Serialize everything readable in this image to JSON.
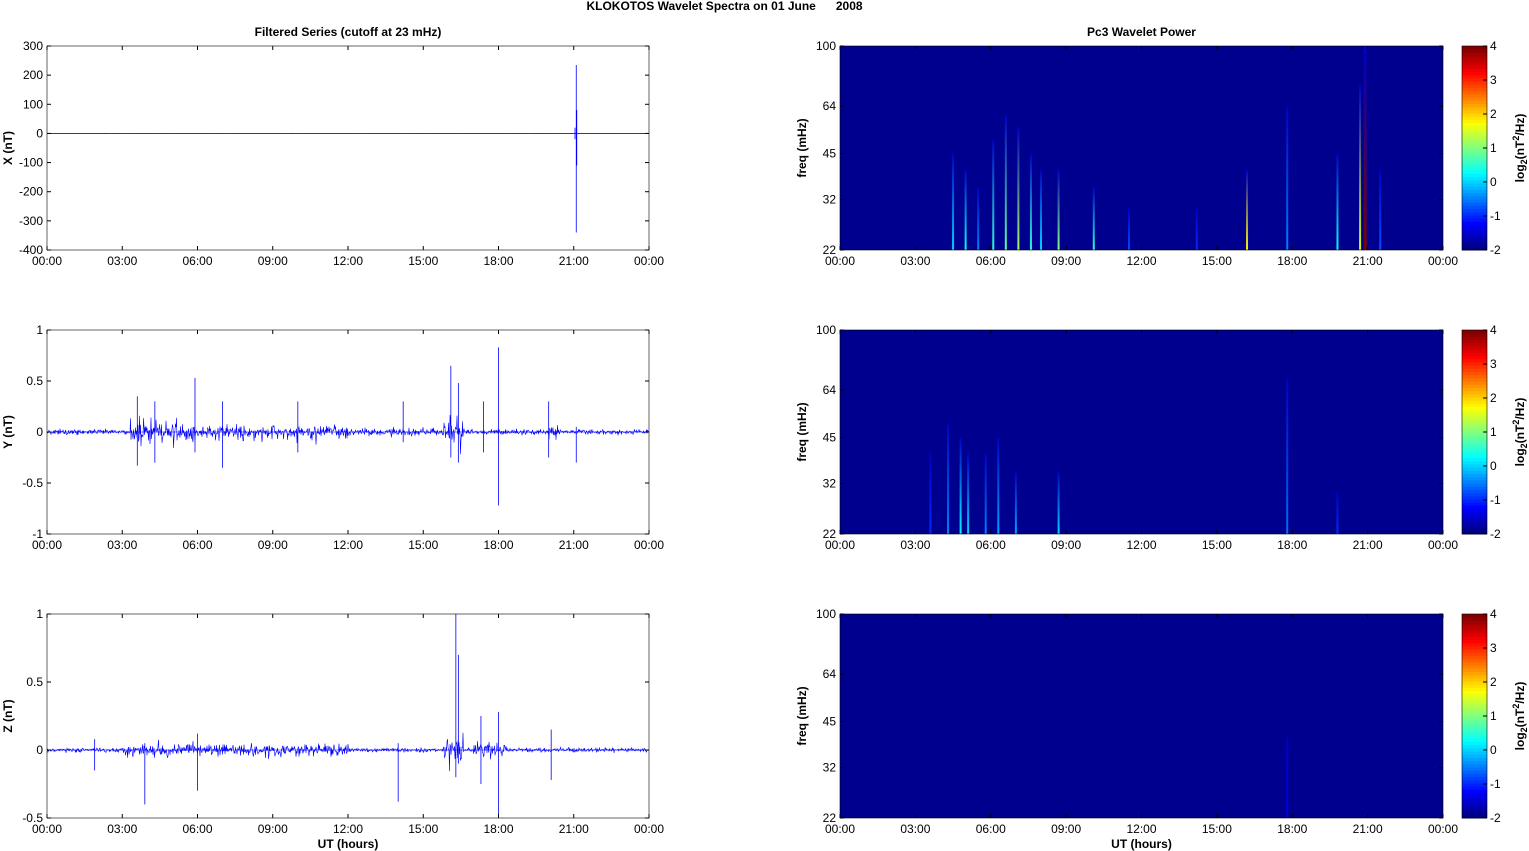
{
  "figure": {
    "title": "KLOKOTOS Wavelet Spectra on 01 June      2008",
    "xlabel": "UT (hours)"
  },
  "colors": {
    "trace": "#0000ff",
    "background": "#00008f"
  },
  "chart_data": [
    {
      "type": "line",
      "panel": "X",
      "title": "Filtered Series (cutoff at 23 mHz)",
      "ylabel": "X (nT)",
      "xlabel": "",
      "xlim": [
        0,
        24
      ],
      "xticks": [
        "00:00",
        "03:00",
        "06:00",
        "09:00",
        "12:00",
        "15:00",
        "18:00",
        "21:00",
        "00:00"
      ],
      "ylim": [
        -400,
        300
      ],
      "yticks": [
        -400,
        -300,
        -200,
        -100,
        0,
        100,
        200,
        300
      ],
      "noise": 0.4,
      "activity": [],
      "events": [
        {
          "t": 21.1,
          "hi": 235,
          "lo": -340
        },
        {
          "t": 21.12,
          "hi": 80,
          "lo": -110
        },
        {
          "t": 21.05,
          "hi": 20,
          "lo": -20
        }
      ]
    },
    {
      "type": "line",
      "panel": "Y",
      "title": "",
      "ylabel": "Y (nT)",
      "xlabel": "",
      "xlim": [
        0,
        24
      ],
      "xticks": [
        "00:00",
        "03:00",
        "06:00",
        "09:00",
        "12:00",
        "15:00",
        "18:00",
        "21:00",
        "00:00"
      ],
      "ylim": [
        -1,
        1
      ],
      "yticks": [
        -1,
        -0.5,
        0,
        0.5,
        1
      ],
      "noise": 0.025,
      "activity": [
        [
          3.3,
          6.0,
          0.12
        ],
        [
          6.0,
          12.0,
          0.07
        ],
        [
          12,
          15.5,
          0.04
        ],
        [
          15.8,
          16.6,
          0.15
        ],
        [
          20.0,
          20.4,
          0.08
        ]
      ],
      "events": [
        {
          "t": 3.6,
          "hi": 0.35,
          "lo": -0.33
        },
        {
          "t": 4.3,
          "hi": 0.3,
          "lo": -0.3
        },
        {
          "t": 5.9,
          "hi": 0.53,
          "lo": -0.2
        },
        {
          "t": 7.0,
          "hi": 0.3,
          "lo": -0.35
        },
        {
          "t": 10.0,
          "hi": 0.3,
          "lo": -0.2
        },
        {
          "t": 14.2,
          "hi": 0.3,
          "lo": -0.1
        },
        {
          "t": 16.1,
          "hi": 0.65,
          "lo": -0.25
        },
        {
          "t": 16.4,
          "hi": 0.48,
          "lo": -0.3
        },
        {
          "t": 18.0,
          "hi": 0.83,
          "lo": -0.72
        },
        {
          "t": 17.4,
          "hi": 0.3,
          "lo": -0.2
        },
        {
          "t": 20.0,
          "hi": 0.3,
          "lo": -0.25
        },
        {
          "t": 21.1,
          "hi": 0.05,
          "lo": -0.3
        }
      ]
    },
    {
      "type": "line",
      "panel": "Z",
      "title": "",
      "ylabel": "Z (nT)",
      "xlabel": "UT (hours)",
      "xlim": [
        0,
        24
      ],
      "xticks": [
        "00:00",
        "03:00",
        "06:00",
        "09:00",
        "12:00",
        "15:00",
        "18:00",
        "21:00",
        "00:00"
      ],
      "ylim": [
        -0.5,
        1
      ],
      "yticks": [
        -0.5,
        0,
        0.5,
        1
      ],
      "noise": 0.015,
      "activity": [
        [
          3.0,
          12.0,
          0.05
        ],
        [
          15.8,
          16.6,
          0.12
        ],
        [
          17.0,
          18.3,
          0.06
        ]
      ],
      "events": [
        {
          "t": 1.9,
          "hi": 0.08,
          "lo": -0.15
        },
        {
          "t": 3.9,
          "hi": 0.05,
          "lo": -0.4
        },
        {
          "t": 6.0,
          "hi": 0.12,
          "lo": -0.3
        },
        {
          "t": 14.0,
          "hi": 0.05,
          "lo": -0.38
        },
        {
          "t": 16.3,
          "hi": 1.0,
          "lo": -0.2
        },
        {
          "t": 16.4,
          "hi": 0.7,
          "lo": -0.1
        },
        {
          "t": 17.3,
          "hi": 0.25,
          "lo": -0.25
        },
        {
          "t": 18.0,
          "hi": 0.28,
          "lo": -0.48
        },
        {
          "t": 20.1,
          "hi": 0.15,
          "lo": -0.22
        }
      ]
    },
    {
      "type": "heatmap",
      "panel": "X",
      "title": "Pc3 Wavelet Power",
      "ylabel": "freq (mHz)",
      "xlabel": "",
      "xlim": [
        0,
        24
      ],
      "xticks": [
        "00:00",
        "03:00",
        "06:00",
        "09:00",
        "12:00",
        "15:00",
        "18:00",
        "21:00",
        "00:00"
      ],
      "ylim": [
        22,
        100
      ],
      "yticks": [
        22,
        32,
        45,
        64,
        100
      ],
      "clabel": "log2(nT²/Hz)",
      "clim": [
        -2,
        4
      ],
      "cticks": [
        -2,
        -1,
        0,
        1,
        2,
        3,
        4
      ],
      "bands": [
        {
          "t": 4.5,
          "fmax": 45,
          "p": 0
        },
        {
          "t": 5.0,
          "fmax": 40,
          "p": 0.3
        },
        {
          "t": 5.5,
          "fmax": 35,
          "p": -0.5
        },
        {
          "t": 6.1,
          "fmax": 50,
          "p": 0.5
        },
        {
          "t": 6.6,
          "fmax": 60,
          "p": 0.8
        },
        {
          "t": 7.1,
          "fmax": 55,
          "p": 1.2
        },
        {
          "t": 7.6,
          "fmax": 45,
          "p": 0.5
        },
        {
          "t": 8.0,
          "fmax": 40,
          "p": 0
        },
        {
          "t": 8.7,
          "fmax": 40,
          "p": 1.0
        },
        {
          "t": 10.1,
          "fmax": 35,
          "p": 0.5
        },
        {
          "t": 11.5,
          "fmax": 30,
          "p": -0.8
        },
        {
          "t": 14.2,
          "fmax": 30,
          "p": -1
        },
        {
          "t": 16.2,
          "fmax": 40,
          "p": 1.8
        },
        {
          "t": 17.8,
          "fmax": 64,
          "p": -0.5
        },
        {
          "t": 19.8,
          "fmax": 45,
          "p": 0.3
        },
        {
          "t": 20.7,
          "fmax": 75,
          "p": 1.5
        },
        {
          "t": 20.9,
          "fmax": 100,
          "p": 4
        },
        {
          "t": 21.5,
          "fmax": 40,
          "p": -0.8
        }
      ]
    },
    {
      "type": "heatmap",
      "panel": "Y",
      "title": "",
      "ylabel": "freq (mHz)",
      "xlabel": "",
      "xlim": [
        0,
        24
      ],
      "xticks": [
        "00:00",
        "03:00",
        "06:00",
        "09:00",
        "12:00",
        "15:00",
        "18:00",
        "21:00",
        "00:00"
      ],
      "ylim": [
        22,
        100
      ],
      "yticks": [
        22,
        32,
        45,
        64,
        100
      ],
      "clabel": "log2(nT²/Hz)",
      "clim": [
        -2,
        4
      ],
      "cticks": [
        -2,
        -1,
        0,
        1,
        2,
        3,
        4
      ],
      "bands": [
        {
          "t": 3.6,
          "fmax": 40,
          "p": -1
        },
        {
          "t": 4.3,
          "fmax": 50,
          "p": -0.5
        },
        {
          "t": 4.8,
          "fmax": 45,
          "p": 0.2
        },
        {
          "t": 5.1,
          "fmax": 40,
          "p": 0
        },
        {
          "t": 5.8,
          "fmax": 40,
          "p": -0.5
        },
        {
          "t": 6.3,
          "fmax": 45,
          "p": -0.3
        },
        {
          "t": 7.0,
          "fmax": 35,
          "p": -0.3
        },
        {
          "t": 8.7,
          "fmax": 35,
          "p": 0
        },
        {
          "t": 17.8,
          "fmax": 70,
          "p": -0.6
        },
        {
          "t": 19.8,
          "fmax": 30,
          "p": -1
        }
      ]
    },
    {
      "type": "heatmap",
      "panel": "Z",
      "title": "",
      "ylabel": "freq (mHz)",
      "xlabel": "UT (hours)",
      "xlim": [
        0,
        24
      ],
      "xticks": [
        "00:00",
        "03:00",
        "06:00",
        "09:00",
        "12:00",
        "15:00",
        "18:00",
        "21:00",
        "00:00"
      ],
      "ylim": [
        22,
        100
      ],
      "yticks": [
        22,
        32,
        45,
        64,
        100
      ],
      "clabel": "log2(nT²/Hz)",
      "clim": [
        -2,
        4
      ],
      "cticks": [
        -2,
        -1,
        0,
        1,
        2,
        3,
        4
      ],
      "bands": [
        {
          "t": 17.8,
          "fmax": 40,
          "p": -1.4
        }
      ]
    }
  ]
}
